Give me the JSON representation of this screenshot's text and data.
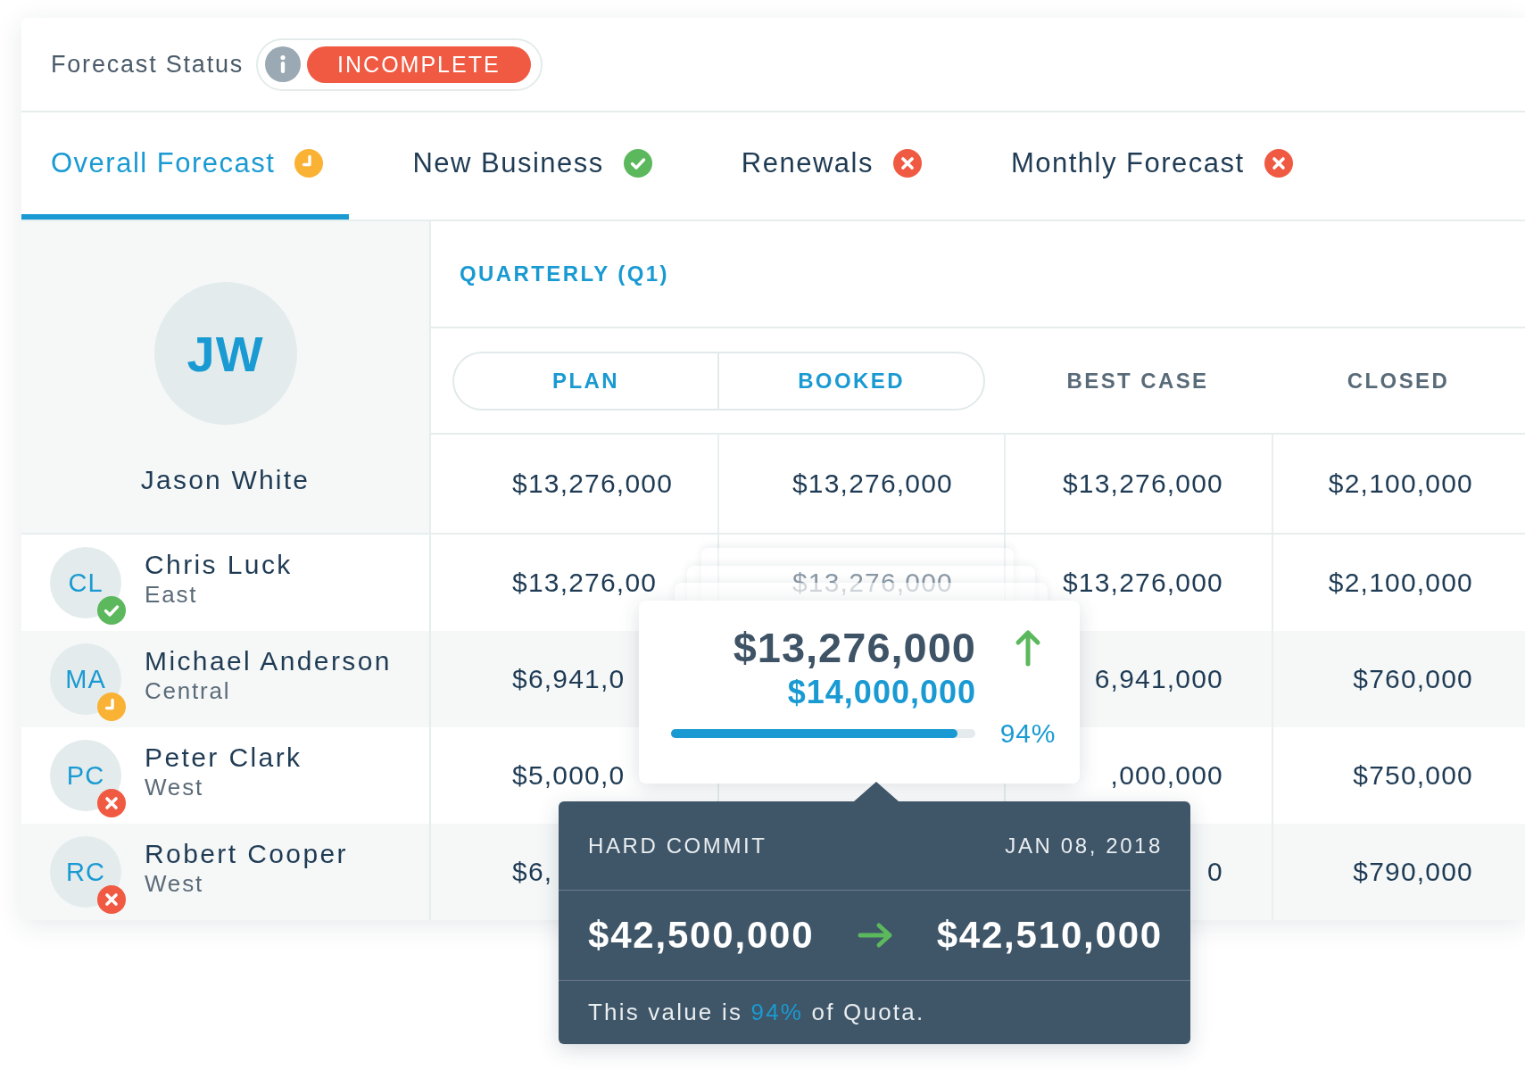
{
  "forecast_status": {
    "label": "Forecast Status",
    "badge": "INCOMPLETE"
  },
  "tabs": [
    {
      "label": "Overall Forecast",
      "kind": "pending",
      "selected": true
    },
    {
      "label": "New Business",
      "kind": "complete",
      "selected": false
    },
    {
      "label": "Renewals",
      "kind": "incomplete",
      "selected": false
    },
    {
      "label": "Monthly Forecast",
      "kind": "incomplete",
      "selected": false
    }
  ],
  "period": "QUARTERLY (Q1)",
  "columns": [
    {
      "label": "PLAN",
      "selected": true
    },
    {
      "label": "BOOKED",
      "selected": true
    },
    {
      "label": "BEST CASE",
      "selected": false
    },
    {
      "label": "CLOSED",
      "selected": false
    }
  ],
  "owner": {
    "initials": "JW",
    "name": "Jason White",
    "plan": "$13,276,000",
    "booked": "$13,276,000",
    "best_case": "$13,276,000",
    "closed": "$2,100,000"
  },
  "team": [
    {
      "initials": "CL",
      "name": "Chris Luck",
      "region": "East",
      "kind": "complete",
      "plan": "$13,276,00",
      "booked": "$13,276,000",
      "best_case": "$13,276,000",
      "closed": "$2,100,000"
    },
    {
      "initials": "MA",
      "name": "Michael Anderson",
      "region": "Central",
      "kind": "pending",
      "plan": "$6,941,0",
      "best_case": "6,941,000",
      "closed": "$760,000"
    },
    {
      "initials": "PC",
      "name": "Peter Clark",
      "region": "West",
      "kind": "incomplete",
      "plan": "$5,000,0",
      "best_case": ",000,000",
      "closed": "$750,000"
    },
    {
      "initials": "RC",
      "name": "Robert Cooper",
      "region": "West",
      "kind": "incomplete",
      "plan": "$6,",
      "best_case": "0",
      "closed": "$790,000"
    }
  ],
  "popover": {
    "value": "$13,276,000",
    "target": "$14,000,000",
    "rising": true,
    "level": 0.94,
    "percent": "94%"
  },
  "tooltip": {
    "title": "HARD COMMIT",
    "date": "JAN 08, 2018",
    "from": "$42,500,000",
    "to": "$42,510,000",
    "note": [
      {
        "text": "This value is ",
        "highlight": false
      },
      {
        "text": "94%",
        "highlight": true
      },
      {
        "text": " of Quota.",
        "highlight": false
      }
    ]
  }
}
